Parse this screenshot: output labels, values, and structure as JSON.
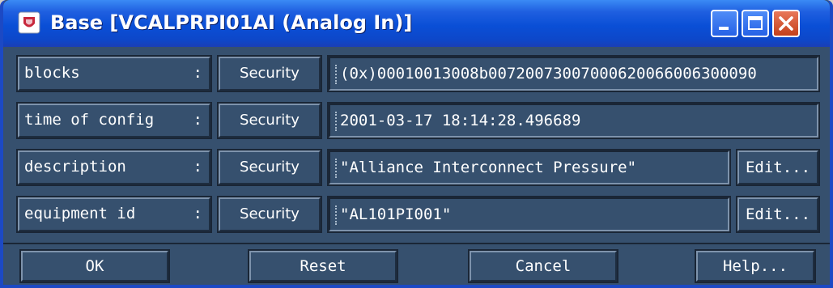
{
  "window": {
    "title": "Base [VCALPRPI01AI (Analog In)]",
    "app_icon": "app-icon",
    "controls": {
      "minimize": "minimize-icon",
      "maximize": "maximize-icon",
      "close": "close-icon"
    }
  },
  "rows": [
    {
      "attribute": "blocks",
      "security_label": "Security",
      "value": "(0x)00010013008b00720073007000620066006300090"
    },
    {
      "attribute": "time of config",
      "security_label": "Security",
      "value": "2001-03-17 18:14:28.496689"
    },
    {
      "attribute": "description",
      "security_label": "Security",
      "value": "\"Alliance Interconnect Pressure\"",
      "edit_label": "Edit..."
    },
    {
      "attribute": "equipment id",
      "security_label": "Security",
      "value": "\"AL101PI001\"",
      "edit_label": "Edit..."
    }
  ],
  "select_indicator": ":",
  "buttons": {
    "ok": "OK",
    "reset": "Reset",
    "cancel": "Cancel",
    "help": "Help..."
  },
  "colors": {
    "titlebar": "#0a4fd6",
    "panel": "#36506e",
    "text": "#ffffff",
    "close_button": "#c4401a"
  }
}
